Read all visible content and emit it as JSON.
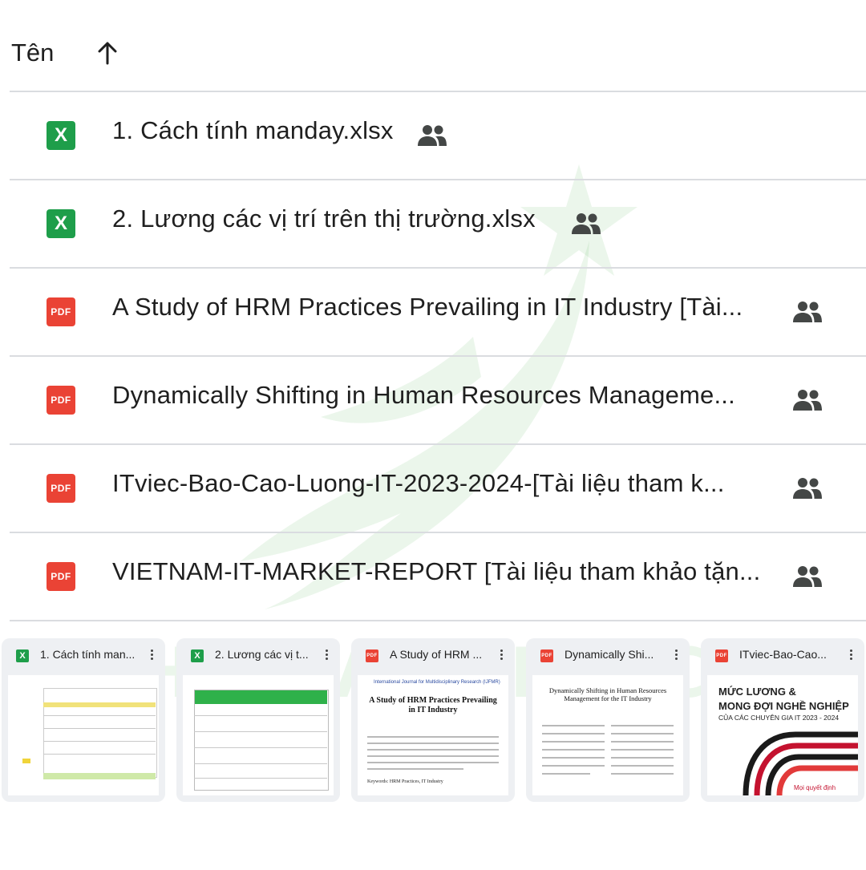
{
  "header": {
    "column_label": "Tên",
    "sort_icon": "arrow-up-icon"
  },
  "files": [
    {
      "type": "xlsx",
      "icon_label": "X",
      "name": "1. Cách tính manday.xlsx",
      "shared_icon": "people-icon"
    },
    {
      "type": "xlsx",
      "icon_label": "X",
      "name": "2. Lương các vị trí trên thị trường.xlsx",
      "shared_icon": "people-icon"
    },
    {
      "type": "pdf",
      "icon_label": "PDF",
      "name": "A Study of HRM Practices Prevailing in IT Industry [Tài...",
      "shared_icon": "people-icon"
    },
    {
      "type": "pdf",
      "icon_label": "PDF",
      "name": "Dynamically Shifting in Human Resources Manageme...",
      "shared_icon": "people-icon"
    },
    {
      "type": "pdf",
      "icon_label": "PDF",
      "name": "ITviec-Bao-Cao-Luong-IT-2023-2024-[Tài liệu tham k...",
      "shared_icon": "people-icon"
    },
    {
      "type": "pdf",
      "icon_label": "PDF",
      "name": "VIETNAM-IT-MARKET-REPORT [Tài liệu tham khảo tặn...",
      "shared_icon": "people-icon"
    }
  ],
  "cards": [
    {
      "type": "xlsx",
      "icon_label": "X",
      "title": "1. Cách tính man..."
    },
    {
      "type": "xlsx",
      "icon_label": "X",
      "title": "2. Lương các vị t..."
    },
    {
      "type": "pdf",
      "icon_label": "PDF",
      "title": "A Study of HRM ...",
      "preview_journal": "International Journal for Multidisciplinary Research (IJFMR)",
      "preview_title": "A Study of HRM Practices Prevailing in IT Industry",
      "preview_keywords": "Keywords: HRM Practices, IT Industry"
    },
    {
      "type": "pdf",
      "icon_label": "PDF",
      "title": "Dynamically Shi...",
      "preview_title": "Dynamically Shifting in Human Resources Management for the IT Industry"
    },
    {
      "type": "pdf",
      "icon_label": "PDF",
      "title": "ITviec-Bao-Cao...",
      "preview_heading_1": "MỨC LƯƠNG &",
      "preview_heading_2": "MONG ĐỢI NGHỀ NGHIỆP",
      "preview_subheading": "CỦA CÁC CHUYÊN GIA IT 2023 - 2024",
      "preview_footer": "Mọi quyết định"
    }
  ],
  "watermark": {
    "text": "HOCVIENHR.COM",
    "color": "#3caa3c"
  },
  "colors": {
    "xlsx": "#1e9e4a",
    "pdf": "#ea4335",
    "divider": "#dadce0",
    "card_bg": "#eef0f3"
  }
}
